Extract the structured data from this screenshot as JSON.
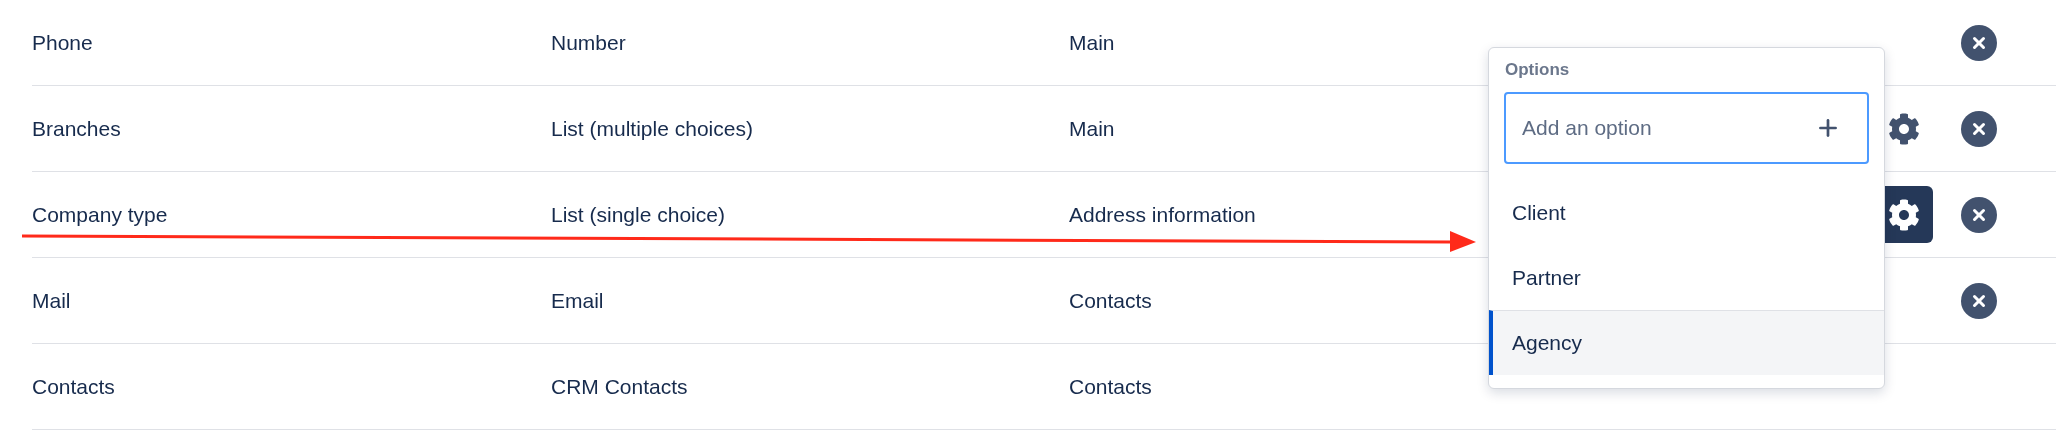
{
  "rows": [
    {
      "name": "Phone",
      "type": "Number",
      "section": "Main",
      "has_settings": false,
      "removable": true
    },
    {
      "name": "Branches",
      "type": "List (multiple choices)",
      "section": "Main",
      "has_settings": true,
      "settings_active": false,
      "removable": true
    },
    {
      "name": "Company type",
      "type": "List (single choice)",
      "section": "Address information",
      "has_settings": true,
      "settings_active": true,
      "removable": true
    },
    {
      "name": "Mail",
      "type": "Email",
      "section": "Contacts",
      "has_settings": false,
      "removable": true
    },
    {
      "name": "Contacts",
      "type": "CRM Contacts",
      "section": "Contacts",
      "has_settings": false,
      "removable": false
    }
  ],
  "options_popup": {
    "title": "Options",
    "input": {
      "placeholder": "Add an option"
    },
    "items": [
      {
        "label": "Client",
        "selected": false
      },
      {
        "label": "Partner",
        "selected": false
      },
      {
        "label": "Agency",
        "selected": true
      }
    ]
  }
}
